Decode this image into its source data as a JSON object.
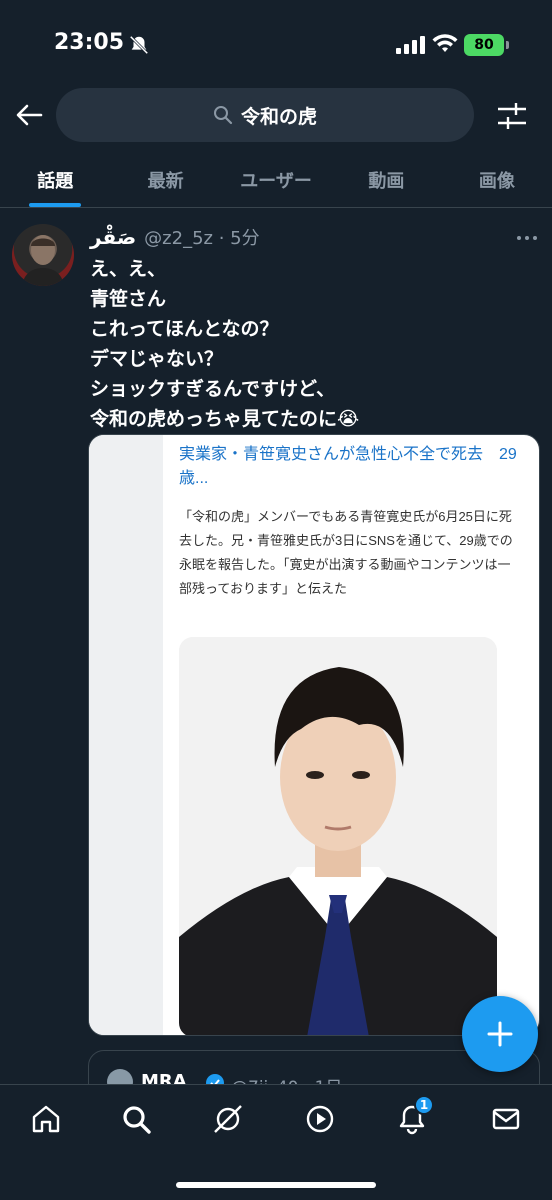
{
  "status_bar": {
    "time": "23:05",
    "battery": "80"
  },
  "search": {
    "query": "令和の虎"
  },
  "tabs": [
    {
      "label": "話題",
      "active": true
    },
    {
      "label": "最新",
      "active": false
    },
    {
      "label": "ユーザー",
      "active": false
    },
    {
      "label": "動画",
      "active": false
    },
    {
      "label": "画像",
      "active": false
    }
  ],
  "tweet": {
    "display_name": "صَقْر",
    "handle_time": "@z2_5z · 5分",
    "lines": [
      "え、え、",
      "青笹さん",
      "これってほんとなの？",
      "デマじゃない？",
      "ショックすぎるんですけど、",
      "令和の虎めっちゃ見てたのに😭"
    ]
  },
  "article": {
    "title": "実業家・青笹寛史さんが急性心不全で死去　29歳...",
    "body": "「令和の虎」メンバーでもある青笹寛史氏が6月25日に死去した。兄・青笹雅史氏が3日にSNSを通じて、29歳での永眠を報告した。「寛史が出演する動画やコンテンツは一部残っております」と伝えた"
  },
  "next_tweet": {
    "name": "MRA",
    "handle_time": "@7ii_40 · 1日"
  },
  "nav": {
    "notifications_badge": "1"
  },
  "colors": {
    "background": "#15202b",
    "accent": "#1d9bf0",
    "muted_text": "#8b98a5",
    "link": "#1a73c8"
  },
  "icons": [
    "back-arrow-icon",
    "search-icon",
    "filter-icon",
    "more-icon",
    "plus-icon",
    "home-icon",
    "explore-icon",
    "grok-icon",
    "video-icon",
    "bell-icon",
    "mail-icon",
    "verified-icon",
    "bell-off-icon",
    "signal-icon",
    "wifi-icon"
  ]
}
